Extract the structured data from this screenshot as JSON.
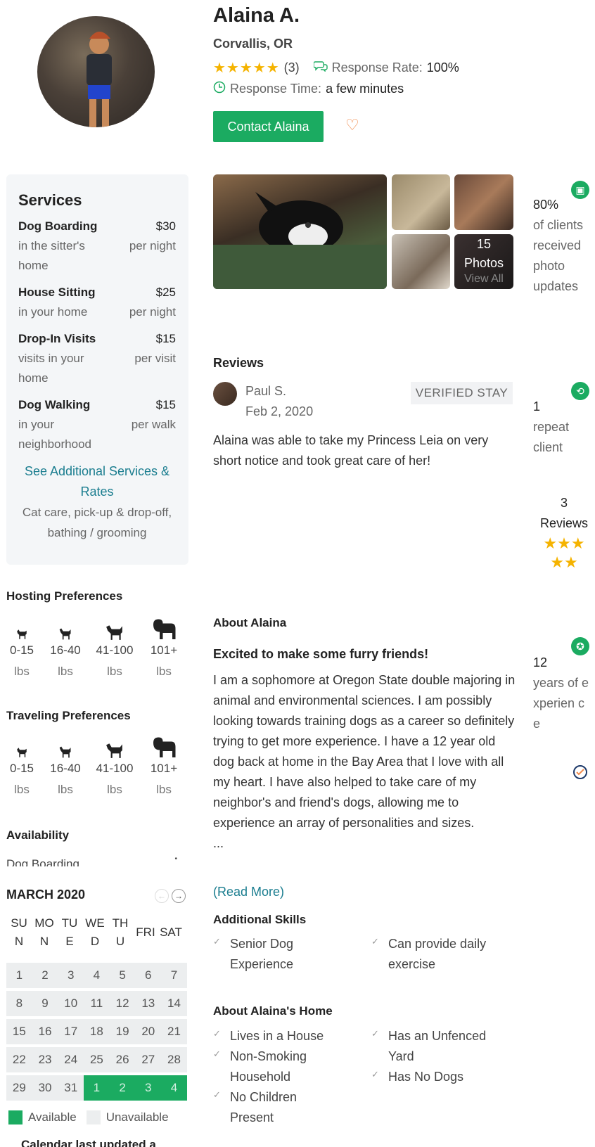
{
  "profile": {
    "name": "Alaina A.",
    "location": "Corvallis, OR",
    "stars": "★★★★★",
    "review_count": "(3)",
    "response_rate_label": "Response Rate:",
    "response_rate_value": "100%",
    "response_time_label": "Response Time:",
    "response_time_value": "a few minutes",
    "contact_label": "Contact Alaina"
  },
  "services": {
    "title": "Services",
    "items": [
      {
        "name": "Dog Boarding",
        "desc": "in the sitter's home",
        "price": "$30",
        "unit": "per night"
      },
      {
        "name": "House Sitting",
        "desc": "in your home",
        "price": "$25",
        "unit": "per night"
      },
      {
        "name": "Drop-In Visits",
        "desc": "visits in your home",
        "price": "$15",
        "unit": "per visit"
      },
      {
        "name": "Dog Walking",
        "desc": "in your neighborhood",
        "price": "$15",
        "unit": "per walk"
      }
    ],
    "see_more": "See Additional Services & Rates",
    "note": "Cat care, pick-up & drop-off, bathing / grooming"
  },
  "photos": {
    "count": "15",
    "label": "Photos",
    "view_all": "View All"
  },
  "stats": {
    "photo": {
      "value": "80%",
      "text": "of clients received photo updates"
    },
    "repeat": {
      "value": "1",
      "text": "repeat client"
    },
    "reviews": {
      "value": "3",
      "text": "Reviews",
      "stars": "★★★★★"
    },
    "experience": {
      "value": "12",
      "text": "years of experien ce"
    }
  },
  "reviews": {
    "title": "Reviews",
    "items": [
      {
        "author": "Paul S.",
        "date": "Feb 2, 2020",
        "badge": "VERIFIED STAY",
        "text": "Alaina was able to take my Princess Leia on very short notice and took great care of her!"
      }
    ]
  },
  "hosting": {
    "title": "Hosting Preferences",
    "sizes": [
      {
        "range": "0-15",
        "unit": "lbs"
      },
      {
        "range": "16-40",
        "unit": "lbs"
      },
      {
        "range": "41-100",
        "unit": "lbs"
      },
      {
        "range": "101+",
        "unit": "lbs"
      }
    ]
  },
  "traveling": {
    "title": "Traveling Preferences",
    "sizes": [
      {
        "range": "0-15",
        "unit": "lbs"
      },
      {
        "range": "16-40",
        "unit": "lbs"
      },
      {
        "range": "41-100",
        "unit": "lbs"
      },
      {
        "range": "101+",
        "unit": "lbs"
      }
    ]
  },
  "availability": {
    "title": "Availability",
    "service_select": "Dog Boarding",
    "month": "MARCH 2020",
    "dow": [
      "SU N",
      "MO N",
      "TU E",
      "WE D",
      "TH U",
      "FRI",
      "SAT"
    ],
    "weeks": [
      [
        {
          "d": "1",
          "a": false
        },
        {
          "d": "2",
          "a": false
        },
        {
          "d": "3",
          "a": false
        },
        {
          "d": "4",
          "a": false
        },
        {
          "d": "5",
          "a": false
        },
        {
          "d": "6",
          "a": false
        },
        {
          "d": "7",
          "a": false
        }
      ],
      [
        {
          "d": "8",
          "a": false
        },
        {
          "d": "9",
          "a": false
        },
        {
          "d": "10",
          "a": false
        },
        {
          "d": "11",
          "a": false
        },
        {
          "d": "12",
          "a": false
        },
        {
          "d": "13",
          "a": false
        },
        {
          "d": "14",
          "a": false
        }
      ],
      [
        {
          "d": "15",
          "a": false
        },
        {
          "d": "16",
          "a": false
        },
        {
          "d": "17",
          "a": false
        },
        {
          "d": "18",
          "a": false
        },
        {
          "d": "19",
          "a": false
        },
        {
          "d": "20",
          "a": false
        },
        {
          "d": "21",
          "a": false
        }
      ],
      [
        {
          "d": "22",
          "a": false
        },
        {
          "d": "23",
          "a": false
        },
        {
          "d": "24",
          "a": false
        },
        {
          "d": "25",
          "a": false
        },
        {
          "d": "26",
          "a": false
        },
        {
          "d": "27",
          "a": false
        },
        {
          "d": "28",
          "a": false
        }
      ],
      [
        {
          "d": "29",
          "a": false
        },
        {
          "d": "30",
          "a": false
        },
        {
          "d": "31",
          "a": false
        },
        {
          "d": "1",
          "a": true
        },
        {
          "d": "2",
          "a": true
        },
        {
          "d": "3",
          "a": true
        },
        {
          "d": "4",
          "a": true
        }
      ]
    ],
    "legend_available": "Available",
    "legend_unavailable": "Unavailable",
    "updated": "Calendar last updated a"
  },
  "about": {
    "title": "About Alaina",
    "headline": "Excited to make some furry friends!",
    "body": "I am a sophomore at Oregon State double majoring in animal and environmental sciences. I am possibly looking towards training dogs as a career so definitely trying to get more experience. I have a 12 year old dog back at home in the Bay Area that I love with all my heart. I have also helped to take care of my neighbor's and friend's dogs, allowing me to experience an array of personalities and sizes.",
    "ellipsis": "...",
    "read_more": "(Read More)"
  },
  "skills": {
    "title": "Additional Skills",
    "left": [
      "Senior Dog Experience"
    ],
    "right": [
      "Can provide daily exercise"
    ]
  },
  "home": {
    "title": "About Alaina's Home",
    "left": [
      "Lives in a House",
      "Non-Smoking Household",
      "No Children Present"
    ],
    "right": [
      "Has an Unfenced Yard",
      "Has No Dogs"
    ]
  },
  "colors": {
    "brand_green": "#1bab61",
    "link_teal": "#1a7d8f",
    "star_yellow": "#f5b300",
    "heart_orange": "#f08a4b"
  }
}
